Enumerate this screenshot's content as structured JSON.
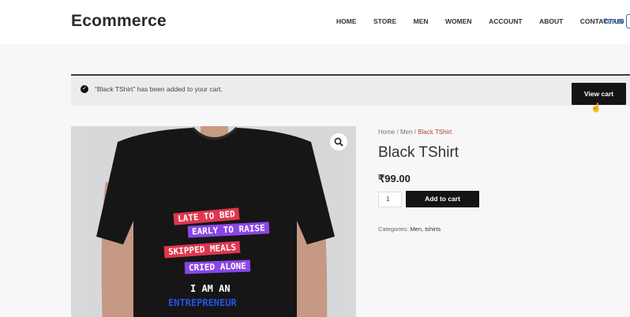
{
  "header": {
    "logo": "Ecommerce",
    "nav": [
      "HOME",
      "STORE",
      "MEN",
      "WOMEN",
      "ACCOUNT",
      "ABOUT",
      "CONTACT US"
    ],
    "cart_total": "₹99.00"
  },
  "notice": {
    "text": "“Black TShirt” has been added to your cart.",
    "button": "View cart"
  },
  "product": {
    "breadcrumb_prefix": "Home / Men / ",
    "breadcrumb_current": "Black TShirt",
    "title": "Black TShirt",
    "price": "₹99.00",
    "quantity": "1",
    "add_to_cart": "Add to cart",
    "categories_label": "Categories: ",
    "categories": "Men, tshirts",
    "shirt_print": [
      "LATE TO BED",
      "EARLY TO RAISE",
      "SKIPPED MEALS",
      "CRIED ALONE",
      "I AM AN",
      "ENTREPRENEUR"
    ]
  },
  "colors": {
    "accent_link": "#3a5fbf",
    "breadcrumb_current": "#b0413e",
    "button_bg": "#141414"
  }
}
